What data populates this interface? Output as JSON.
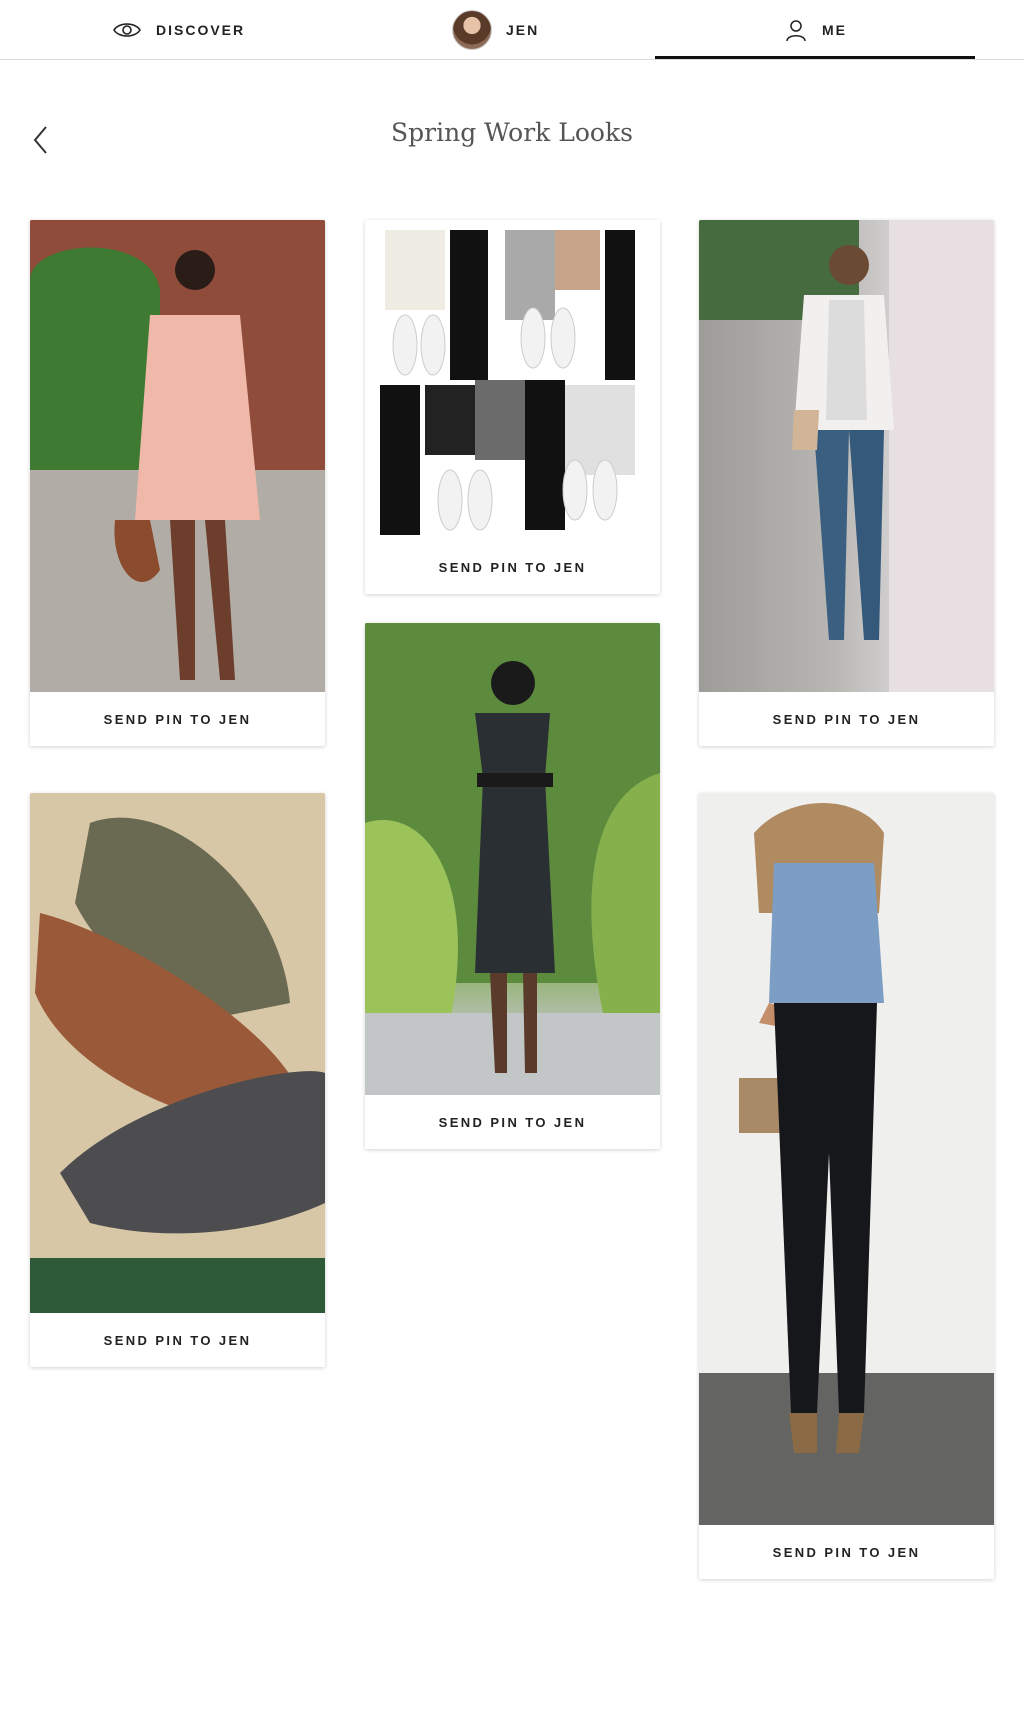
{
  "nav": {
    "discover_label": "DISCOVER",
    "jen_label": "JEN",
    "me_label": "ME",
    "active_tab": "ME"
  },
  "page": {
    "title": "Spring Work Looks"
  },
  "pins": [
    {
      "button_label": "SEND PIN TO JEN"
    },
    {
      "button_label": "SEND PIN TO JEN"
    },
    {
      "button_label": "SEND PIN TO JEN"
    },
    {
      "button_label": "SEND PIN TO JEN"
    },
    {
      "button_label": "SEND PIN TO JEN"
    },
    {
      "button_label": "SEND PIN TO JEN"
    }
  ]
}
